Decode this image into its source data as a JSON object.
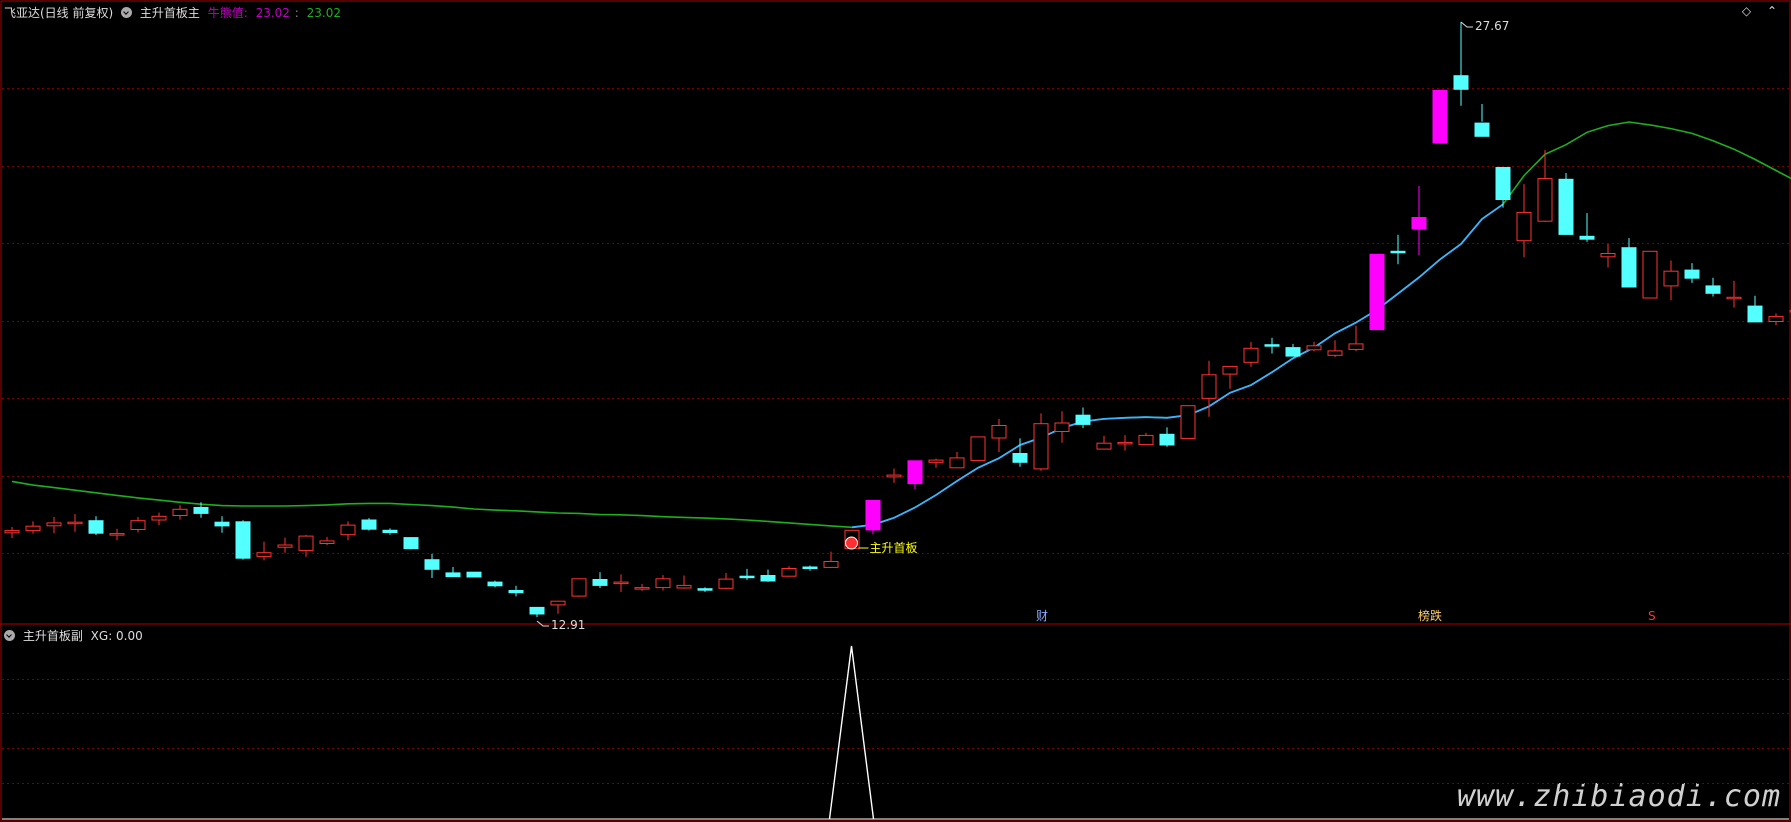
{
  "header": {
    "title": "飞亚达(日线 前复权)",
    "indicator_main": "主升首板主",
    "niu_label": "牛熊值:",
    "niu_value1": "23.02",
    "niu_sep": ":",
    "niu_value2": "23.02"
  },
  "sub_header": {
    "indicator_sub": "主升首板副",
    "xg_label": "XG: 0.00"
  },
  "watermark": "www.zhibiaodi.com",
  "colors": {
    "up": "#ff3232",
    "down": "#54ffff",
    "signal": "#ff00ff",
    "ma_long": "#1fae1f",
    "ma_short": "#3db2ff",
    "grid": "#7a0000",
    "frame": "#b00000"
  },
  "chart_data": [
    {
      "type": "candlestick",
      "max_label": "27.67",
      "min_label": "12.91",
      "signal_label": "主升首板",
      "event_markers": [
        "财",
        "榜跌",
        "S"
      ],
      "ohlc": [
        [
          13.99,
          14.15,
          13.85,
          14.05
        ],
        [
          14.05,
          14.3,
          13.97,
          14.17
        ],
        [
          14.18,
          14.42,
          13.98,
          14.26
        ],
        [
          14.26,
          14.5,
          14.02,
          14.28
        ],
        [
          14.32,
          14.44,
          13.93,
          13.98
        ],
        [
          13.93,
          14.1,
          13.79,
          13.97
        ],
        [
          14.08,
          14.42,
          14.0,
          14.32
        ],
        [
          14.34,
          14.54,
          14.2,
          14.44
        ],
        [
          14.46,
          14.74,
          14.35,
          14.63
        ],
        [
          14.68,
          14.82,
          14.4,
          14.52
        ],
        [
          14.28,
          14.44,
          13.99,
          14.18
        ],
        [
          14.29,
          14.33,
          13.26,
          13.3
        ],
        [
          13.35,
          13.75,
          13.24,
          13.45
        ],
        [
          13.6,
          13.86,
          13.45,
          13.66
        ],
        [
          13.51,
          13.93,
          13.34,
          13.9
        ],
        [
          13.7,
          13.88,
          13.66,
          13.77
        ],
        [
          13.94,
          14.3,
          13.79,
          14.2
        ],
        [
          14.34,
          14.39,
          14.05,
          14.09
        ],
        [
          14.06,
          14.11,
          13.94,
          14.0
        ],
        [
          13.86,
          13.87,
          13.54,
          13.56
        ],
        [
          13.26,
          13.42,
          12.76,
          13.0
        ],
        [
          12.9,
          13.06,
          12.81,
          12.8
        ],
        [
          12.92,
          12.92,
          12.78,
          12.79
        ],
        [
          12.65,
          12.69,
          12.51,
          12.55
        ],
        [
          12.42,
          12.55,
          12.26,
          12.36
        ],
        [
          11.96,
          11.96,
          11.7,
          11.78
        ],
        [
          12.03,
          12.14,
          11.79,
          12.13
        ],
        [
          12.27,
          12.75,
          12.25,
          12.74
        ],
        [
          12.72,
          12.92,
          12.49,
          12.56
        ],
        [
          12.64,
          12.86,
          12.38,
          12.65
        ],
        [
          12.48,
          12.6,
          12.41,
          12.5
        ],
        [
          12.5,
          12.84,
          12.42,
          12.74
        ],
        [
          12.49,
          12.83,
          12.47,
          12.56
        ],
        [
          12.47,
          12.51,
          12.38,
          12.45
        ],
        [
          12.48,
          12.9,
          12.46,
          12.73
        ],
        [
          12.81,
          13.01,
          12.71,
          12.8
        ],
        [
          12.83,
          12.99,
          12.66,
          12.68
        ],
        [
          12.81,
          13.08,
          12.8,
          13.02
        ],
        [
          13.06,
          13.1,
          12.96,
          13.03
        ],
        [
          13.05,
          13.48,
          13.04,
          13.21
        ],
        [
          13.56,
          14.0,
          13.56,
          14.06
        ],
        [
          14.07,
          14.87,
          13.95,
          14.87
        ],
        [
          15.51,
          15.74,
          15.35,
          15.56
        ],
        [
          15.33,
          15.94,
          15.18,
          15.95
        ],
        [
          15.91,
          16.01,
          15.76,
          15.97
        ],
        [
          15.76,
          16.19,
          15.77,
          16.03
        ],
        [
          15.96,
          16.12,
          15.96,
          16.6
        ],
        [
          16.57,
          17.09,
          16.19,
          16.91
        ],
        [
          16.15,
          16.56,
          15.79,
          15.91
        ],
        [
          15.73,
          17.24,
          15.68,
          16.96
        ],
        [
          16.75,
          17.3,
          16.44,
          16.98
        ],
        [
          17.19,
          17.4,
          16.84,
          16.94
        ],
        [
          16.27,
          16.63,
          16.27,
          16.43
        ],
        [
          16.42,
          16.65,
          16.23,
          16.45
        ],
        [
          16.39,
          16.71,
          16.37,
          16.64
        ],
        [
          16.67,
          16.86,
          16.33,
          16.38
        ],
        [
          16.56,
          17.1,
          16.55,
          17.45
        ],
        [
          17.65,
          18.67,
          17.15,
          18.29
        ],
        [
          18.31,
          18.44,
          17.91,
          18.52
        ],
        [
          18.63,
          19.18,
          18.51,
          19.01
        ],
        [
          19.11,
          19.3,
          18.87,
          19.09
        ],
        [
          19.03,
          19.13,
          18.83,
          18.8
        ],
        [
          18.97,
          19.19,
          18.93,
          19.08
        ],
        [
          18.82,
          19.23,
          18.77,
          18.94
        ],
        [
          18.98,
          19.63,
          18.93,
          19.13
        ],
        [
          19.52,
          21.43,
          19.51,
          21.57
        ],
        [
          21.65,
          22.1,
          21.3,
          21.64
        ],
        [
          22.26,
          23.43,
          21.55,
          22.57
        ],
        [
          24.6,
          25.73,
          24.62,
          26.03
        ],
        [
          26.43,
          27.89,
          25.61,
          26.06
        ],
        [
          25.14,
          25.66,
          25.18,
          24.78
        ],
        [
          23.93,
          23.85,
          22.84,
          23.06
        ],
        [
          21.94,
          23.48,
          21.49,
          22.71
        ],
        [
          22.47,
          24.41,
          22.45,
          23.63
        ],
        [
          23.61,
          23.78,
          22.76,
          22.11
        ],
        [
          22.06,
          22.69,
          21.91,
          21.98
        ],
        [
          21.5,
          21.85,
          21.21,
          21.59
        ],
        [
          21.75,
          22.01,
          20.92,
          20.68
        ],
        [
          20.38,
          20.81,
          20.83,
          21.65
        ],
        [
          20.71,
          21.4,
          20.32,
          21.11
        ],
        [
          21.14,
          21.33,
          20.79,
          20.92
        ],
        [
          20.71,
          20.93,
          20.42,
          20.51
        ],
        [
          20.39,
          20.85,
          20.12,
          20.4
        ],
        [
          20.16,
          20.44,
          19.95,
          19.73
        ],
        [
          19.74,
          19.96,
          19.64,
          19.88
        ],
        [
          20.01,
          20.32,
          19.8,
          20.04
        ],
        [
          20.24,
          20.59,
          19.96,
          20.5
        ],
        [
          20.57,
          20.48,
          19.7,
          19.62
        ]
      ],
      "ma_long": [
        15.39,
        15.29,
        15.22,
        15.15,
        15.08,
        15.01,
        14.94,
        14.88,
        14.82,
        14.77,
        14.73,
        14.72,
        14.72,
        14.72,
        14.73,
        14.75,
        14.78,
        14.79,
        14.79,
        14.76,
        14.73,
        14.69,
        14.64,
        14.61,
        14.59,
        14.56,
        14.53,
        14.52,
        14.49,
        14.48,
        14.46,
        14.43,
        14.41,
        14.39,
        14.37,
        14.34,
        14.3,
        14.26,
        14.22,
        14.18,
        14.14,
        14.21,
        14.4,
        14.68,
        15.02,
        15.4,
        15.76,
        16.02,
        16.38,
        16.58,
        16.84,
        17.02,
        17.09,
        17.12,
        17.14,
        17.12,
        17.19,
        17.43,
        17.8,
        18.01,
        18.36,
        18.74,
        19.03,
        19.42,
        19.71,
        20.06,
        20.5,
        20.94,
        21.43,
        21.85,
        22.53,
        22.93,
        23.71,
        24.29,
        24.55,
        24.89,
        25.07,
        25.17,
        25.09,
        24.99,
        24.86,
        24.66,
        24.43,
        24.15,
        23.85,
        23.55,
        23.24,
        22.82
      ]
    },
    {
      "type": "line",
      "name": "XG",
      "spike_index": 40,
      "values": [
        0,
        1,
        0
      ]
    }
  ]
}
